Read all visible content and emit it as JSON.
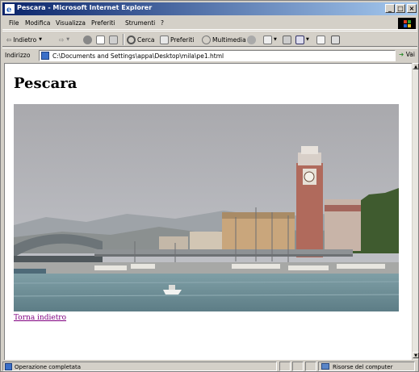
{
  "window": {
    "title": "Pescara - Microsoft Internet Explorer"
  },
  "menu": [
    "File",
    "Modifica",
    "Visualizza",
    "Preferiti",
    "Strumenti",
    "?"
  ],
  "toolbar": {
    "back": "Indietro",
    "search": "Cerca",
    "favorites": "Preferiti",
    "media": "Multimedia"
  },
  "address": {
    "label": "Indirizzo",
    "url": "C:\\Documents and Settings\\appa\\Desktop\\mila\\pe1.html",
    "go": "Vai"
  },
  "page": {
    "heading": "Pescara",
    "link": "Torna indietro"
  },
  "status": {
    "text": "Operazione completata",
    "zone": "Risorse del computer"
  }
}
